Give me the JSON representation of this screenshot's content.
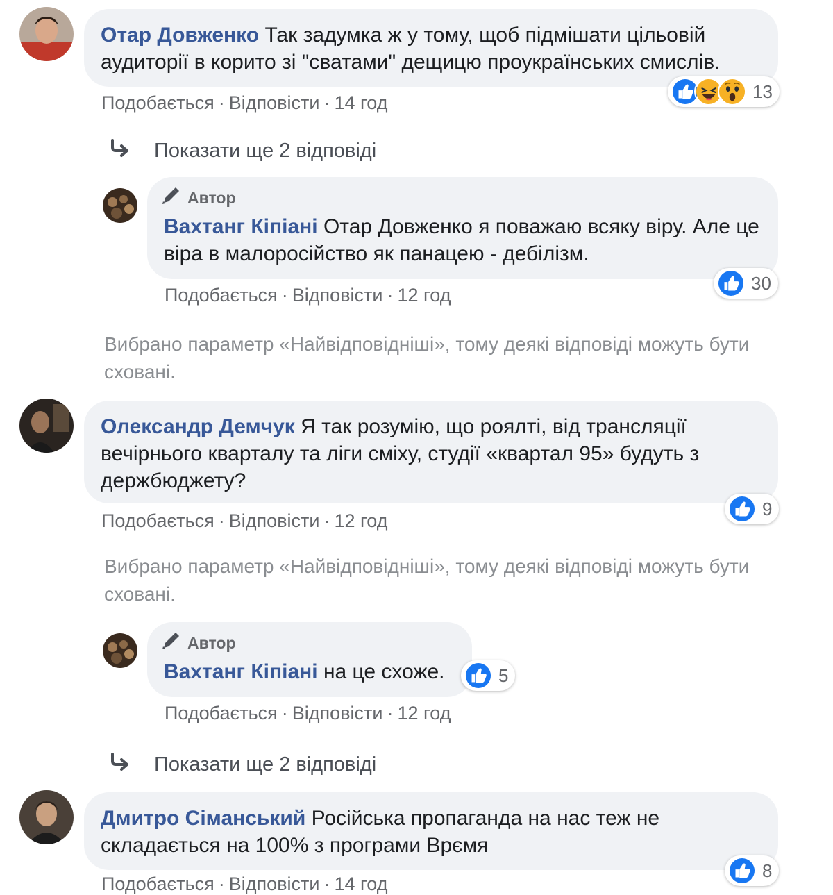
{
  "colors": {
    "name": "#385898",
    "bubble": "#f0f2f5",
    "meta": "#65676b",
    "like": "#1877f2",
    "emoji": "#f7b125"
  },
  "labels": {
    "like": "Подобається",
    "reply": "Відповісти",
    "sep": "·",
    "author_badge": "Автор",
    "show_more": "Показати ще 2 відповіді",
    "notice": "Вибрано параметр «Найвідповідніші», тому деякі відповіді можуть бути сховані."
  },
  "comments": [
    {
      "author": "Отар Довженко",
      "text": "Так задумка ж у тому, щоб підмішати цільовій аудиторії в корито зі \"сватами\" дещицю проукраїнських смислів.",
      "time": "14 год",
      "reactions": {
        "icons": [
          "like-icon",
          "haha-icon",
          "wow-icon"
        ],
        "count": "13"
      }
    },
    {
      "author": "Вахтанг Кіпіані",
      "text_prefix": "Отар Довженко",
      "text": " я поважаю всяку віру. Але це віра в малоросійство як панацею - дебілізм.",
      "time": "12 год",
      "reactions": {
        "icons": [
          "like-icon"
        ],
        "count": "30"
      }
    },
    {
      "author": "Олександр Демчук",
      "text": "Я так розумію, що роялті, від трансляції вечірнього кварталу та ліги сміху, студії «квартал 95» будуть з держбюджету?",
      "time": "12 год",
      "reactions": {
        "icons": [
          "like-icon"
        ],
        "count": "9"
      }
    },
    {
      "author": "Вахтанг Кіпіані",
      "text": "на це схоже.",
      "time": "12 год",
      "reactions": {
        "icons": [
          "like-icon"
        ],
        "count": "5"
      }
    },
    {
      "author": "Дмитро Сіманський",
      "text": "Російська пропаганда на нас теж не складається на 100% з програми Врємя",
      "time": "14 год",
      "reactions": {
        "icons": [
          "like-icon"
        ],
        "count": "8"
      }
    }
  ]
}
